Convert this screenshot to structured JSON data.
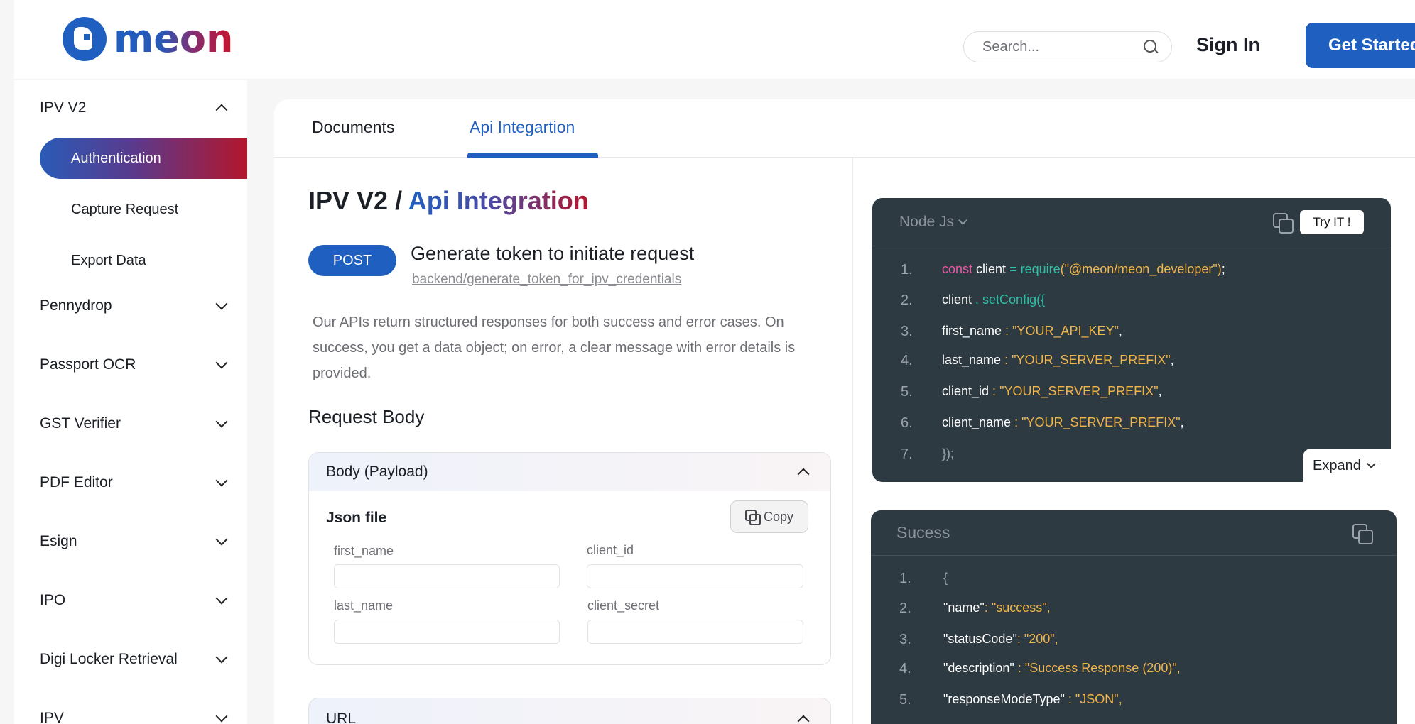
{
  "header": {
    "logo_text": "meon",
    "search_placeholder": "Search...",
    "signin_label": "Sign In",
    "getstarted_label": "Get Started"
  },
  "sidebar": {
    "items": [
      {
        "label": "IPV V2",
        "expanded": true
      },
      {
        "label": "Pennydrop"
      },
      {
        "label": "Passport OCR"
      },
      {
        "label": "GST Verifier"
      },
      {
        "label": "PDF Editor"
      },
      {
        "label": "Esign"
      },
      {
        "label": "IPO"
      },
      {
        "label": "Digi Locker Retrieval"
      },
      {
        "label": "IPV"
      }
    ],
    "sub_items": [
      {
        "label": "Authentication",
        "active": true
      },
      {
        "label": "Capture Request"
      },
      {
        "label": "Export Data"
      }
    ]
  },
  "tabs": [
    {
      "label": "Documents"
    },
    {
      "label": "Api Integartion",
      "active": true
    }
  ],
  "page": {
    "crumb_prefix": "IPV V2 /",
    "crumb_title": "Api Integration",
    "method": "POST",
    "endpoint_title": "Generate token to initiate request",
    "endpoint_path": "backend/generate_token_for_ipv_credentials",
    "description": "Our APIs return structured responses for both success and error cases. On success, you get a data object; on error, a clear message with error details is provided.",
    "request_body_title": "Request Body",
    "body_box": {
      "title": "Body (Payload)",
      "json_label": "Json file",
      "copy_label": "Copy",
      "fields": [
        "first_name",
        "client_id",
        "last_name",
        "client_secret"
      ]
    },
    "url_box_title": "URL"
  },
  "code_request": {
    "language": "Node Js",
    "try_label": "Try IT !",
    "expand_label": "Expand",
    "line_numbers": [
      "1.",
      "2.",
      "3.",
      "4.",
      "5.",
      "6.",
      "7."
    ],
    "lines": {
      "l1_kw": "const",
      "l1_var": " client ",
      "l1_eq": "= ",
      "l1_fn": "require",
      "l1_str": "(\"@meon/meon_developer\")",
      "l1_end": ";",
      "l2_obj": "client",
      "l2_fn": " . setConfig({",
      "l3_key": " first_name",
      "l3_sep": " : ",
      "l3_val": "\"YOUR_API_KEY\"",
      "l4_key": " last_name",
      "l4_val": "\"YOUR_SERVER_PREFIX\"",
      "l5_key": " client_id",
      "l5_val": "\"YOUR_SERVER_PREFIX\"",
      "l6_key": " client_name",
      "l6_val": "\"YOUR_SERVER_PREFIX\"",
      "l7": "});",
      "comma": ","
    }
  },
  "code_response": {
    "title": "Sucess",
    "line_numbers": [
      "1.",
      "2.",
      "3.",
      "4.",
      "5."
    ],
    "lines": {
      "l1": "{",
      "l2_key": "\"name\"",
      "l2_val": " \"success\"",
      "l3_key": "\"statusCode\"",
      "l3_val": " \"200\"",
      "l4_key": "\"description\"",
      "l4_val": " \"Success Response (200)\"",
      "l5_key": "\"responseModeType\"",
      "l5_val": " \"JSON\"",
      "colon": ":",
      "spaced_colon": " :",
      "comma": ","
    }
  },
  "colors": {
    "brand_blue": "#1f5fbf",
    "brand_red": "#b3162d",
    "code_bg": "#2e3a42",
    "string": "#f1b54a",
    "keyword": "#e65aa6",
    "function": "#2fbfa6"
  }
}
